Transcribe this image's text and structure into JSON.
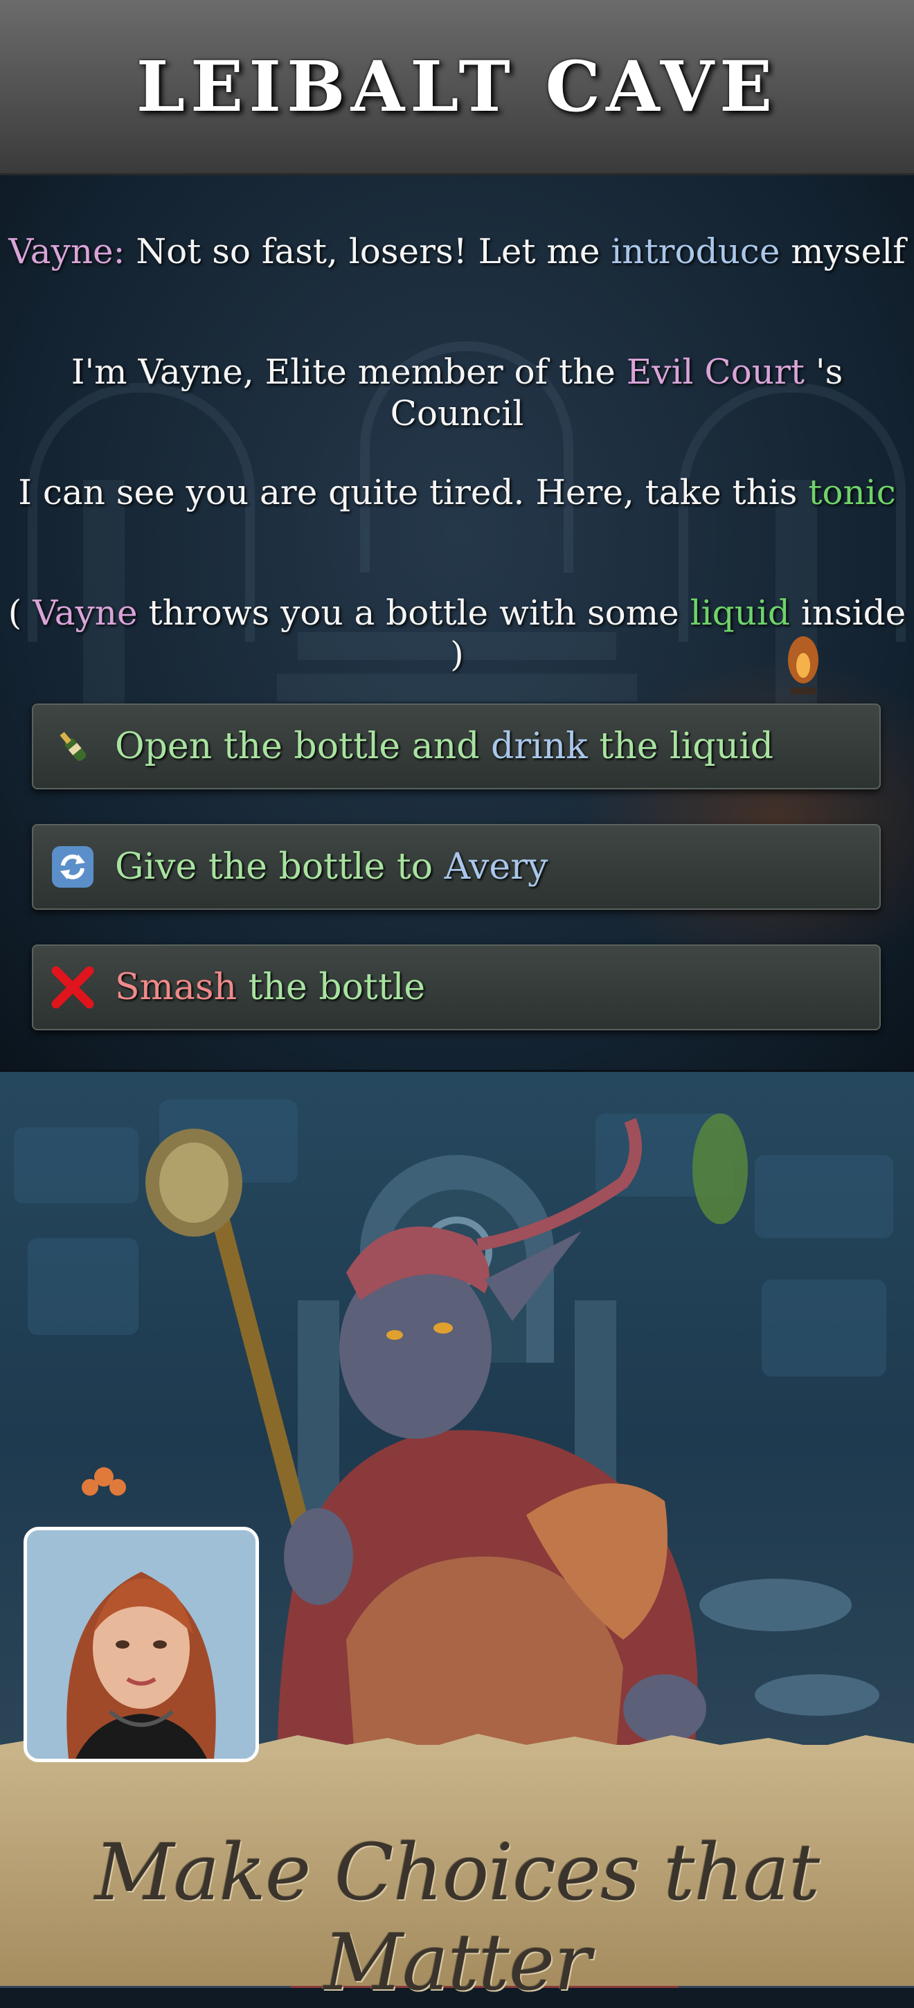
{
  "header": {
    "title": "LEIBALT CAVE"
  },
  "dialogue": {
    "line1": {
      "speaker": "Vayne:",
      "a": " Not so fast, losers! Let me ",
      "highlight": "introduce",
      "b": " myself"
    },
    "line2": {
      "a": "I'm Vayne, Elite member of the ",
      "highlight": "Evil Court",
      "b": " 's Council"
    },
    "line3": {
      "a": "I can see you are quite tired. Here, take this ",
      "highlight": "tonic"
    },
    "line4": {
      "a": "( ",
      "speaker": "Vayne",
      "b": " throws you a bottle with some ",
      "highlight": "liquid",
      "c": " inside )"
    }
  },
  "choices": [
    {
      "icon": "champagne-bottle-icon",
      "a": "Open the bottle and ",
      "highlight": "drink",
      "b": " the liquid"
    },
    {
      "icon": "refresh-arrows-icon",
      "a": "Give the bottle to ",
      "highlight": "Avery"
    },
    {
      "icon": "red-cross-icon",
      "highlight": "Smash",
      "b": " the bottle"
    }
  ],
  "banner": {
    "text": "Make Choices that Matter"
  },
  "colors": {
    "speaker": "#d9a4d8",
    "keyword_blue": "#a9c7ea",
    "keyword_green": "#6fd36a",
    "choice_text": "#a8e3a0",
    "danger": "#f08a8a"
  }
}
